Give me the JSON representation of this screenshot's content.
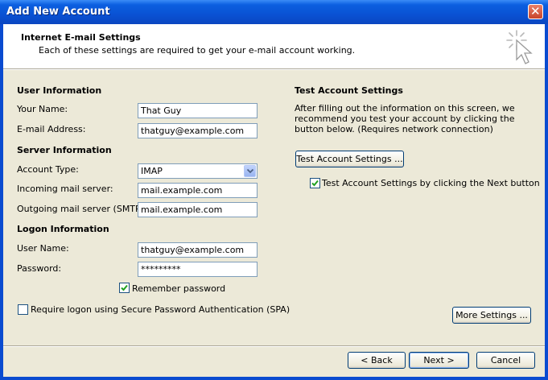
{
  "window": {
    "title": "Add New Account"
  },
  "header": {
    "title": "Internet E-mail Settings",
    "description": "Each of these settings are required to get your e-mail account working."
  },
  "user_info": {
    "title": "User Information",
    "name_label": "Your Name:",
    "name_value": "That Guy",
    "email_label": "E-mail Address:",
    "email_value": "thatguy@example.com"
  },
  "server_info": {
    "title": "Server Information",
    "account_type_label": "Account Type:",
    "account_type_value": "IMAP",
    "incoming_label": "Incoming mail server:",
    "incoming_value": "mail.example.com",
    "outgoing_label": "Outgoing mail server (SMTP):",
    "outgoing_value": "mail.example.com"
  },
  "logon_info": {
    "title": "Logon Information",
    "username_label": "User Name:",
    "username_value": "thatguy@example.com",
    "password_label": "Password:",
    "password_value": "*********",
    "remember_label": "Remember password",
    "remember_checked": true,
    "spa_label": "Require logon using Secure Password Authentication (SPA)",
    "spa_checked": false
  },
  "test_settings": {
    "title": "Test Account Settings",
    "description": "After filling out the information on this screen, we recommend you test your account by clicking the button below. (Requires network connection)",
    "button_label": "Test Account Settings ...",
    "next_check_label": "Test Account Settings by clicking the Next button",
    "next_checked": true
  },
  "buttons": {
    "more_settings": "More Settings ...",
    "back": "< Back",
    "next": "Next >",
    "cancel": "Cancel"
  },
  "colors": {
    "titlebar": "#0a52d4",
    "dialog_bg": "#ece9d8",
    "check_green": "#21a121",
    "close_red": "#c8442a"
  }
}
